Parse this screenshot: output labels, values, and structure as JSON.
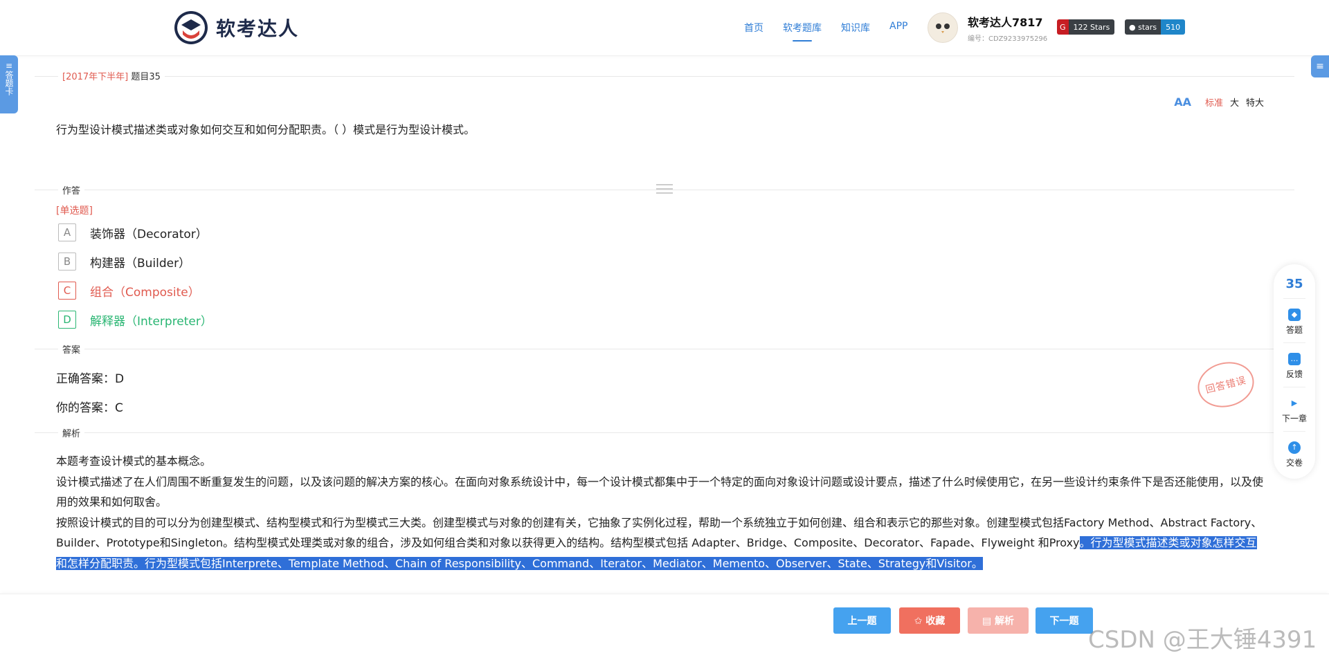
{
  "header": {
    "logo_text": "软考达人",
    "nav": [
      "首页",
      "软考题库",
      "知识库",
      "APP"
    ],
    "user_name": "软考达人7817",
    "user_id": "编号：CDZ9233975296",
    "gitee_stars": "122 Stars",
    "github_label": "stars",
    "github_count": "510"
  },
  "side_left": "答题卡",
  "question": {
    "year_tag": "[2017年下半年]",
    "number": "题目35",
    "text": "行为型设计模式描述类或对象如何交互和如何分配职责。（ ）模式是行为型设计模式。",
    "font_sizes": [
      "标准",
      "大",
      "特大"
    ],
    "font_icon": "AA"
  },
  "answer_section": {
    "label": "作答",
    "type": "[单选题]",
    "options": [
      {
        "letter": "A",
        "text": "装饰器（Decorator）",
        "state": "normal"
      },
      {
        "letter": "B",
        "text": "构建器（Builder）",
        "state": "normal"
      },
      {
        "letter": "C",
        "text": "组合（Composite）",
        "state": "wrong"
      },
      {
        "letter": "D",
        "text": "解释器（Interpreter）",
        "state": "correct"
      }
    ]
  },
  "result": {
    "label": "答案",
    "correct": "正确答案：D",
    "yours": "你的答案：C",
    "stamp": "回答错误"
  },
  "analysis": {
    "label": "解析",
    "p1": "本题考查设计模式的基本概念。",
    "p2": "设计模式描述了在人们周围不断重复发生的问题，以及该问题的解决方案的核心。在面向对象系统设计中，每一个设计模式都集中于一个特定的面向对象设计问题或设计要点，描述了什么时候使用它，在另一些设计约束条件下是否还能使用，以及使用的效果和如何取舍。",
    "p3": "按照设计模式的目的可以分为创建型模式、结构型模式和行为型模式三大类。创建型模式与对象的创建有关，它抽象了实例化过程，帮助一个系统独立于如何创建、组合和表示它的那些对象。创建型模式包括Factory Method、Abstract Factory、Builder、Prototype和Singleton。结构型模式处理类或对象的组合，涉及如何组合类和对象以获得更入的结构。结构型模式包括 Adapter、Bridge、Composite、Decorator、Fapade、Flyweight 和Proxy",
    "p3_highlight": "。行为型模式描述类或对象怎样交互和怎样分配职责。行为型模式包括Interprete、Template Method、Chain of Responsibility、Command、Iterator、Mediator、Memento、Observer、State、Strategy和Visitor。"
  },
  "right_panel": {
    "number": "35",
    "items": [
      "答题",
      "反馈",
      "下一章",
      "交卷"
    ]
  },
  "bottom": {
    "prev": "上一题",
    "fav": "✩ 收藏",
    "ana": "▤ 解析",
    "next": "下一题"
  },
  "watermark": "CSDN @王大锤4391"
}
